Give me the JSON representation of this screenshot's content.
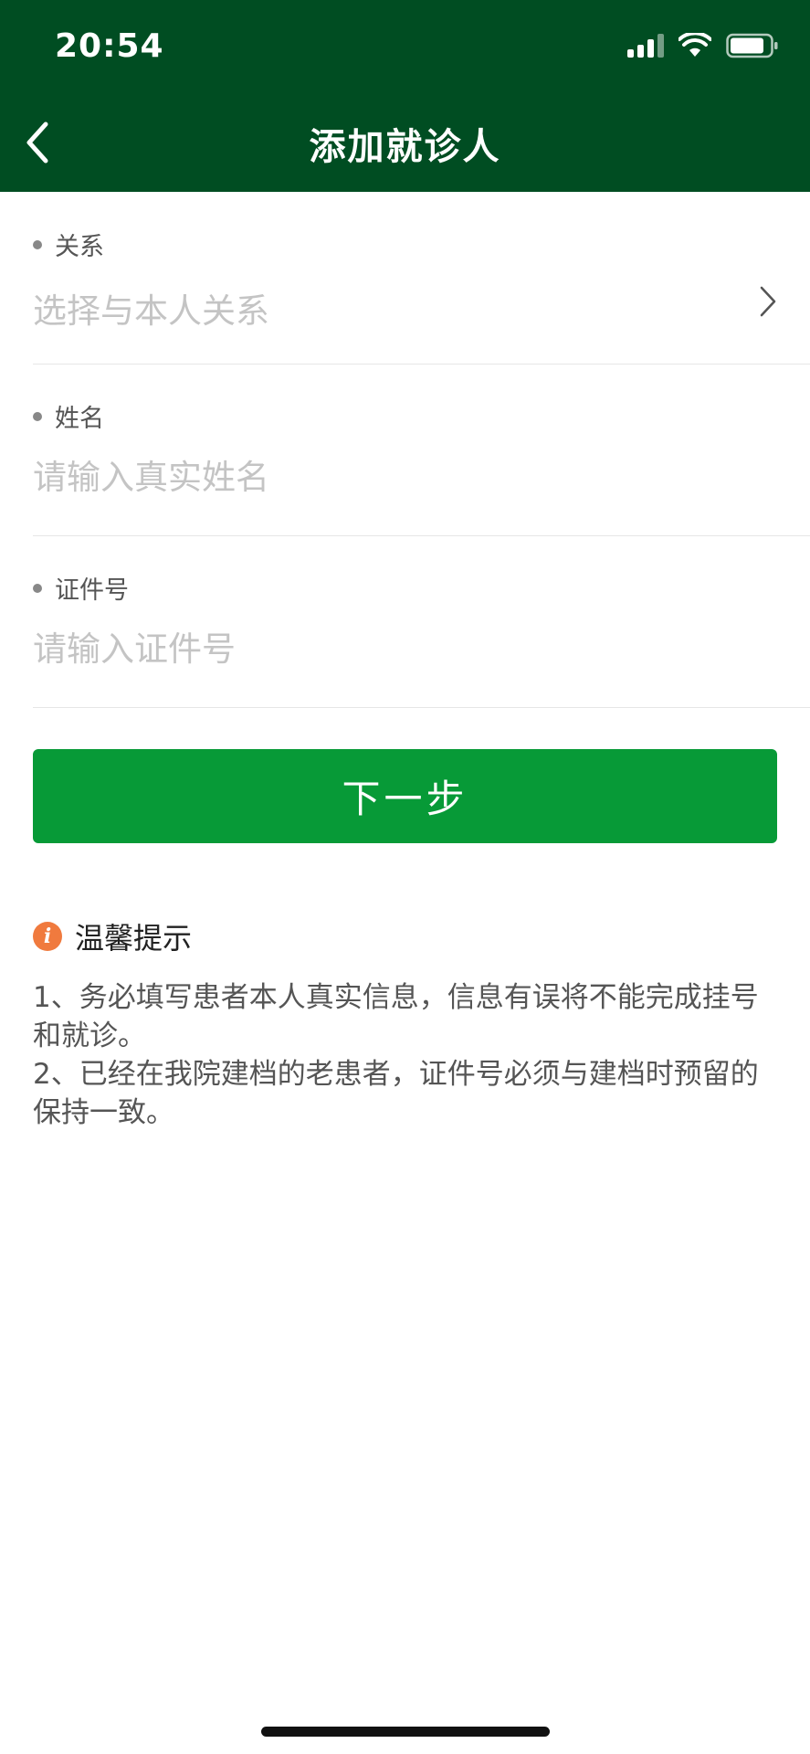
{
  "status_bar": {
    "time": "20:54",
    "icons": [
      "signal-icon",
      "wifi-icon",
      "battery-icon"
    ]
  },
  "nav": {
    "back_icon": "chevron-left-icon",
    "title": "添加就诊人"
  },
  "form": {
    "relation": {
      "label": "关系",
      "placeholder": "选择与本人关系",
      "icon": "chevron-right-icon"
    },
    "name": {
      "label": "姓名",
      "placeholder": "请输入真实姓名"
    },
    "id_number": {
      "label": "证件号",
      "placeholder": "请输入证件号"
    }
  },
  "actions": {
    "next_label": "下一步"
  },
  "tips": {
    "icon": "info-icon",
    "icon_glyph": "i",
    "title": "温馨提示",
    "items": [
      "1、务必填写患者本人真实信息，信息有误将不能完成挂号和就诊。",
      "2、已经在我院建档的老患者，证件号必须与建档时预留的保持一致。"
    ]
  },
  "colors": {
    "header_bg": "#004d22",
    "button_bg": "#079a37",
    "info_icon": "#f07a3e"
  }
}
